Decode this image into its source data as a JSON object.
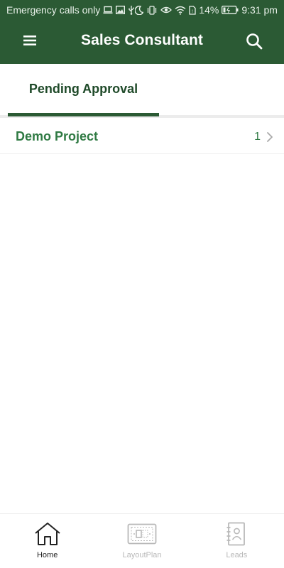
{
  "colors": {
    "primary": "#2b5a34",
    "accent_text": "#2f7a43",
    "inactive": "#b9b9b9"
  },
  "status_bar": {
    "carrier_text": "Emergency calls only",
    "battery_percent": "14%",
    "time": "9:31 pm",
    "icons": [
      "laptop-icon",
      "image-icon",
      "usb-icon",
      "moon-icon",
      "vibrate-icon",
      "eye-icon",
      "wifi-icon",
      "sim-icon",
      "battery-icon"
    ]
  },
  "app_bar": {
    "title": "Sales Consultant",
    "menu_icon": "menu-icon",
    "search_icon": "search-icon"
  },
  "tabs": [
    {
      "label": "Pending Approval",
      "selected": true
    }
  ],
  "list": {
    "items": [
      {
        "name": "Demo Project",
        "count": "1",
        "trailing_icon": "chevron-right-icon"
      }
    ]
  },
  "bottom_nav": {
    "items": [
      {
        "label": "Home",
        "icon": "home-icon",
        "active": true
      },
      {
        "label": "LayoutPlan",
        "icon": "layout-plan-icon",
        "active": false
      },
      {
        "label": "Leads",
        "icon": "contacts-book-icon",
        "active": false
      }
    ]
  }
}
